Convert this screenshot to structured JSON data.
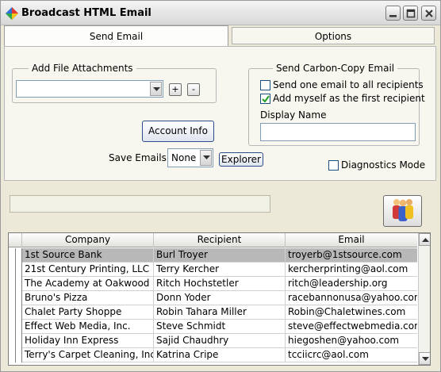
{
  "window": {
    "title": "Broadcast HTML Email"
  },
  "tabs": [
    {
      "label": "Send Email",
      "active": true
    },
    {
      "label": "Options",
      "active": false
    }
  ],
  "attachments": {
    "title": "Add File Attachments",
    "selected": "",
    "add_label": "+",
    "remove_label": "-"
  },
  "account_button": "Account Info",
  "save_emails": {
    "label": "Save Emails",
    "value": "None",
    "explorer_label": "Explorer"
  },
  "cc": {
    "title": "Send Carbon-Copy Email",
    "one_email": {
      "label": "Send one email to all recipients",
      "checked": false
    },
    "add_myself": {
      "label": "Add myself as the first recipient",
      "checked": true
    },
    "display_name_label": "Display Name",
    "display_name_value": ""
  },
  "diagnostics": {
    "label": "Diagnostics Mode",
    "checked": false
  },
  "progress": {
    "value": 0
  },
  "table": {
    "columns": [
      "Company",
      "Recipient",
      "Email"
    ],
    "rows": [
      {
        "company": "1st Source Bank",
        "recipient": "Burl Troyer",
        "email": "troyerb@1stsource.com",
        "selected": true
      },
      {
        "company": "21st Century Printing, LLC",
        "recipient": "Terry Kercher",
        "email": "kercherprinting@aol.com"
      },
      {
        "company": "The Academy at Oakwood",
        "recipient": "Ritch Hochstetler",
        "email": "ritch@leadership.org"
      },
      {
        "company": "Bruno's Pizza",
        "recipient": "Donn Yoder",
        "email": "racebannonusa@yahoo.com"
      },
      {
        "company": "Chalet Party Shoppe",
        "recipient": "Robin Tahara Miller",
        "email": "Robin@Chaletwines.com"
      },
      {
        "company": "Effect Web Media, Inc.",
        "recipient": "Steve Schmidt",
        "email": "steve@effectwebmedia.com"
      },
      {
        "company": "Holiday Inn Express",
        "recipient": "Sajid Chaudhry",
        "email": "hiegoshen@yahoo.com"
      },
      {
        "company": "Terry's Carpet Cleaning, Inc.",
        "recipient": "Katrina Cripe",
        "email": "tcciicrc@aol.com"
      }
    ]
  },
  "icons": [
    "app-logo-icon",
    "minimize-icon",
    "maximize-icon",
    "close-icon",
    "chevron-down-icon",
    "people-icon",
    "scroll-up-icon",
    "scroll-down-icon",
    "checkmark-icon"
  ]
}
